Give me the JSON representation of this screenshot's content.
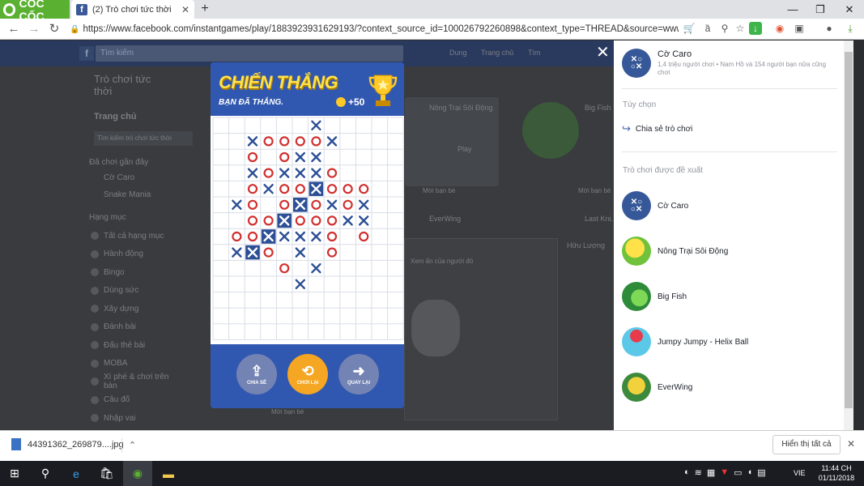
{
  "browser": {
    "logo_text": "CỐC CỐC",
    "tab_title": "(2) Trò chơi tức thời",
    "url": "https://www.facebook.com/instantgames/play/1883923931629193/?context_source_id=100026792260898&context_type=THREAD&source=www_ga..."
  },
  "background_page": {
    "search_placeholder": "Tìm kiếm",
    "user_name": "Dung",
    "home_link": "Trang chủ",
    "find_link": "Tìm",
    "sidebar_title": "Trò chơi tức thời",
    "home": "Trang chủ",
    "search_games": "Tìm kiếm trò chơi tức thời",
    "recent_heading": "Đã chơi gần đây",
    "recent": [
      "Cờ Caro",
      "Snake Mania"
    ],
    "categories_heading": "Hạng mục",
    "categories": [
      "Tất cả hạng mục",
      "Hành động",
      "Bingo",
      "Dùng sức",
      "Xây dựng",
      "Đánh bài",
      "Đấu thẻ bài",
      "MOBA",
      "Xì phé & chơi trên bàn",
      "Câu đố",
      "Nhập vai"
    ],
    "cards": [
      "Nông Trại Sôi Động",
      "Big Fish",
      "EverWing",
      "Last Kni..."
    ],
    "play_label": "Play",
    "invite_label": "Mời bạn bè",
    "chat_text": "Xem ấn của người đó",
    "chat_name": "Hữu Lượng"
  },
  "game_over": {
    "title": "CHIẾN THẮNG",
    "subtitle": "BẠN ĐÃ THẮNG.",
    "coins": "+50",
    "buttons": [
      {
        "label": "CHIA SẺ",
        "color": "#7383b3"
      },
      {
        "label": "CHƠI LẠI",
        "color": "#f5a623"
      },
      {
        "label": "QUAY LẠI",
        "color": "#7383b3"
      }
    ],
    "board_cols": 12,
    "board_rows": 14,
    "pieces": [
      [
        6,
        0,
        "x"
      ],
      [
        2,
        1,
        "x"
      ],
      [
        3,
        1,
        "o"
      ],
      [
        4,
        1,
        "o"
      ],
      [
        5,
        1,
        "o"
      ],
      [
        6,
        1,
        "o"
      ],
      [
        7,
        1,
        "x"
      ],
      [
        2,
        2,
        "o"
      ],
      [
        4,
        2,
        "o"
      ],
      [
        5,
        2,
        "x"
      ],
      [
        6,
        2,
        "x"
      ],
      [
        2,
        3,
        "x"
      ],
      [
        3,
        3,
        "o"
      ],
      [
        4,
        3,
        "x"
      ],
      [
        5,
        3,
        "x"
      ],
      [
        6,
        3,
        "x"
      ],
      [
        7,
        3,
        "o"
      ],
      [
        2,
        4,
        "o"
      ],
      [
        3,
        4,
        "x"
      ],
      [
        4,
        4,
        "o"
      ],
      [
        5,
        4,
        "o"
      ],
      [
        6,
        4,
        "X"
      ],
      [
        7,
        4,
        "o"
      ],
      [
        8,
        4,
        "o"
      ],
      [
        9,
        4,
        "o"
      ],
      [
        1,
        5,
        "x"
      ],
      [
        2,
        5,
        "o"
      ],
      [
        4,
        5,
        "o"
      ],
      [
        5,
        5,
        "X"
      ],
      [
        6,
        5,
        "o"
      ],
      [
        7,
        5,
        "x"
      ],
      [
        8,
        5,
        "o"
      ],
      [
        9,
        5,
        "x"
      ],
      [
        2,
        6,
        "o"
      ],
      [
        3,
        6,
        "o"
      ],
      [
        4,
        6,
        "X"
      ],
      [
        5,
        6,
        "o"
      ],
      [
        6,
        6,
        "o"
      ],
      [
        7,
        6,
        "o"
      ],
      [
        8,
        6,
        "x"
      ],
      [
        9,
        6,
        "x"
      ],
      [
        1,
        7,
        "o"
      ],
      [
        2,
        7,
        "o"
      ],
      [
        3,
        7,
        "X"
      ],
      [
        4,
        7,
        "x"
      ],
      [
        5,
        7,
        "x"
      ],
      [
        6,
        7,
        "x"
      ],
      [
        7,
        7,
        "o"
      ],
      [
        9,
        7,
        "o"
      ],
      [
        1,
        8,
        "x"
      ],
      [
        2,
        8,
        "X"
      ],
      [
        3,
        8,
        "o"
      ],
      [
        5,
        8,
        "x"
      ],
      [
        7,
        8,
        "o"
      ],
      [
        4,
        9,
        "o"
      ],
      [
        6,
        9,
        "x"
      ],
      [
        5,
        10,
        "x"
      ]
    ]
  },
  "right_panel": {
    "game_name": "Cờ Caro",
    "game_stats": "1,4 triệu người chơi • Nam Hồ và 154 người bạn nữa cũng chơi",
    "options_heading": "Tùy chọn",
    "share_label": "Chia sẻ trò chơi",
    "suggested_heading": "Trò chơi được đề xuất",
    "suggested": [
      "Cờ Caro",
      "Nông Trại Sôi Động",
      "Big Fish",
      "Jumpy Jumpy - Helix Ball",
      "EverWing"
    ]
  },
  "downloads": {
    "file_name": "44391362_269879....jpg",
    "show_all": "Hiển thị tất cả"
  },
  "taskbar": {
    "language": "VIE",
    "time": "11:44 CH",
    "date": "01/11/2018"
  }
}
